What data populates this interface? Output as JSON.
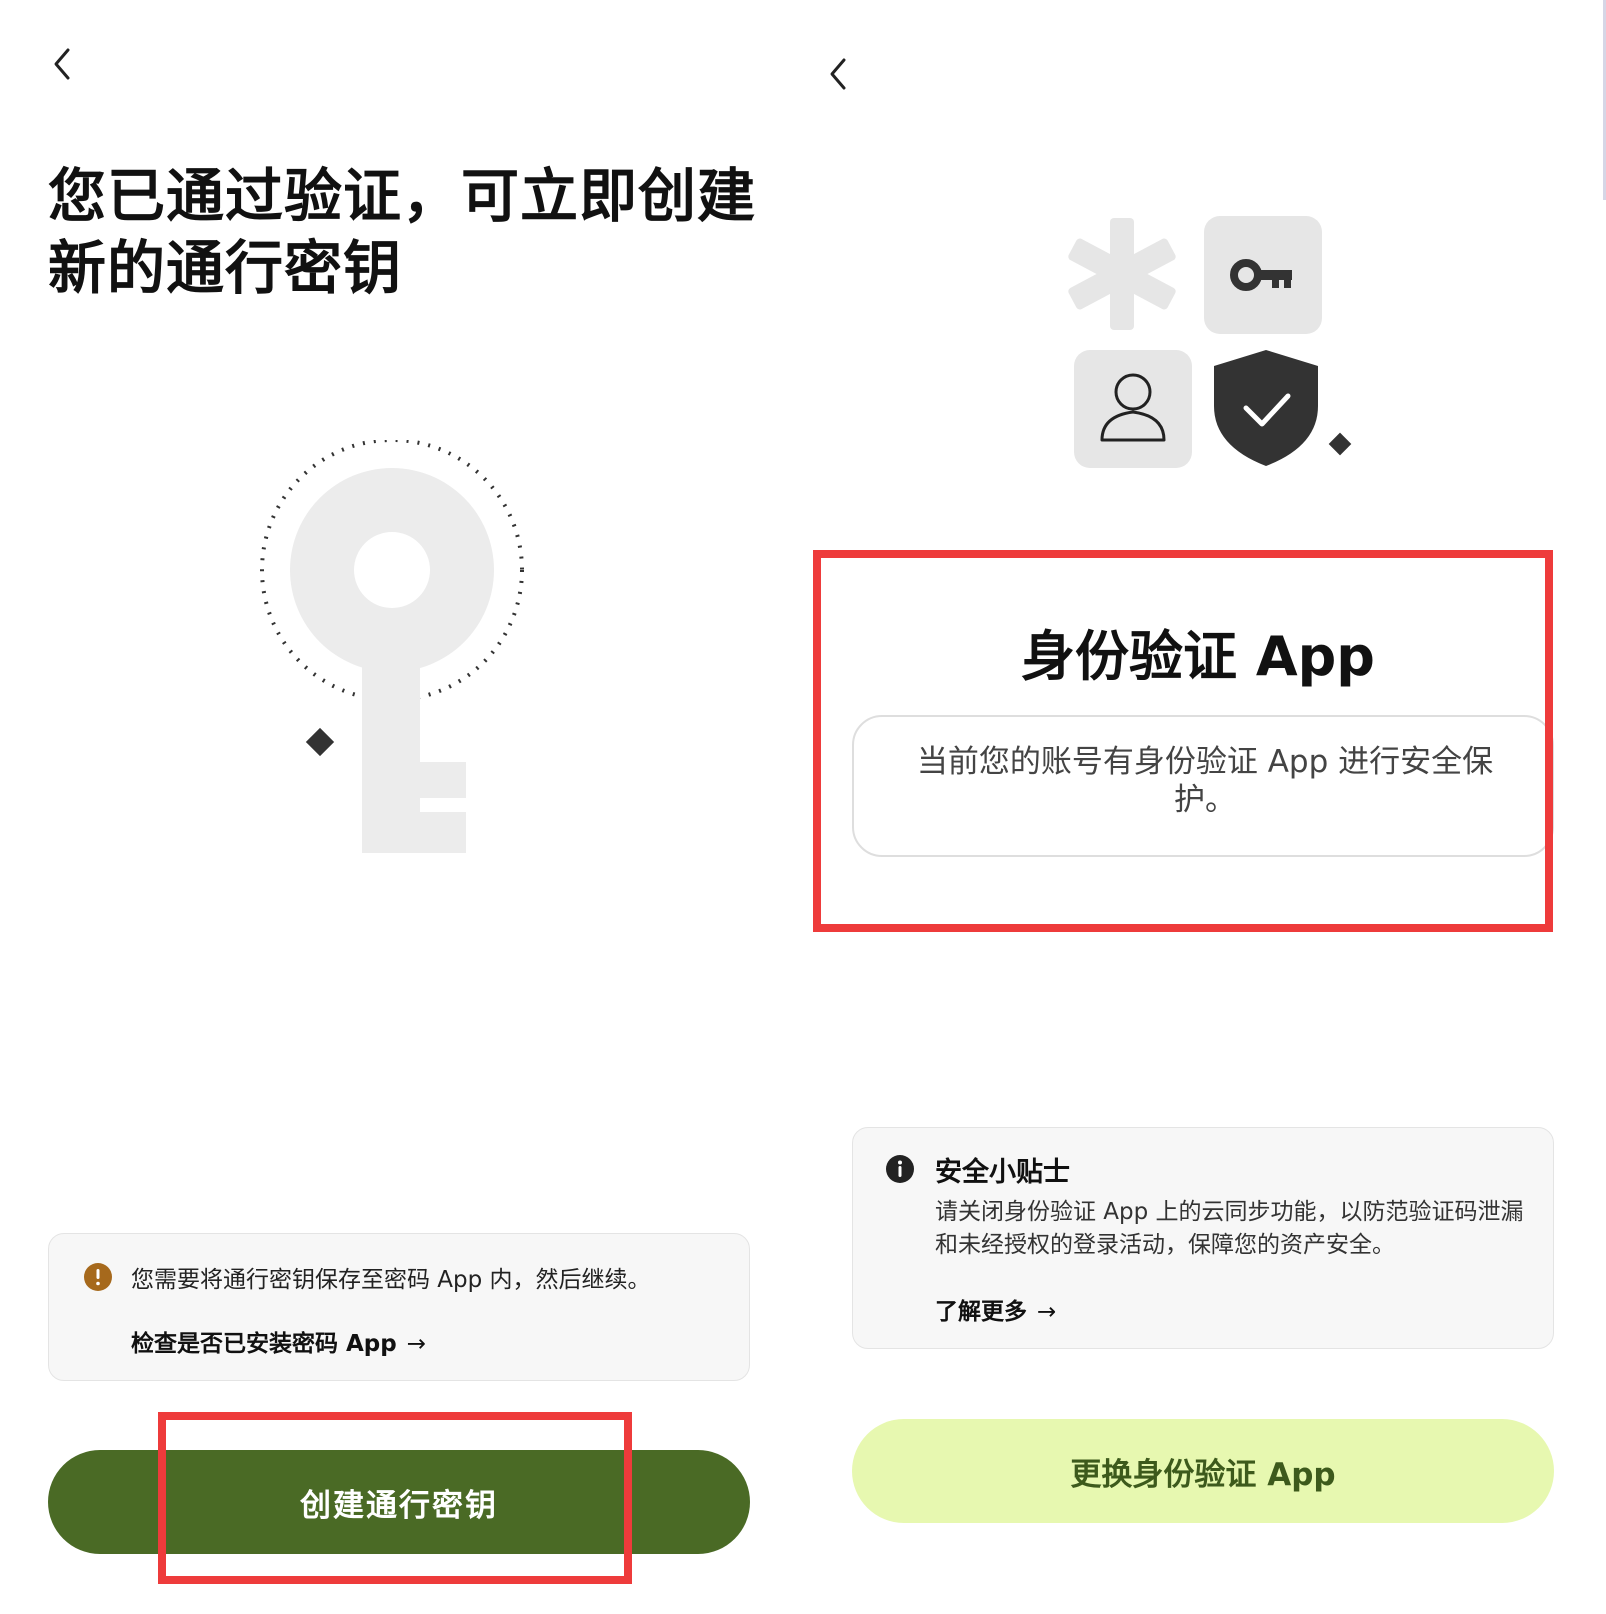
{
  "left": {
    "title_line1": "您已通过验证，可立即创建",
    "title_line2": "新的通行密钥",
    "notice_text": "您需要将通行密钥保存至密码 App 内，然后继续。",
    "notice_link": "检查是否已安装密码 App",
    "arrow": "→",
    "primary_button": "创建通行密钥",
    "icons": {
      "back": "chevron-left-icon",
      "warning": "warning-icon",
      "illustration": "key-icon"
    }
  },
  "right": {
    "section_title": "身份验证 App",
    "description": "当前您的账号有身份验证 App 进行安全保护。",
    "tip_title": "安全小贴士",
    "tip_text": "请关闭身份验证 App 上的云同步功能，以防范验证码泄漏和未经授权的登录活动，保障您的资产安全。",
    "tip_link": "了解更多",
    "arrow": "→",
    "secondary_button": "更换身份验证 App",
    "icons": {
      "back": "chevron-left-icon",
      "info": "info-icon",
      "illustration": [
        "asterisk-icon",
        "key-icon",
        "user-icon",
        "shield-check-icon"
      ]
    }
  },
  "colors": {
    "primary_button": "#4a6a25",
    "secondary_button": "#e7f8b0",
    "secondary_button_text": "#3d5a1c",
    "highlight": "#ee3b3b",
    "warning": "#a6691c"
  }
}
